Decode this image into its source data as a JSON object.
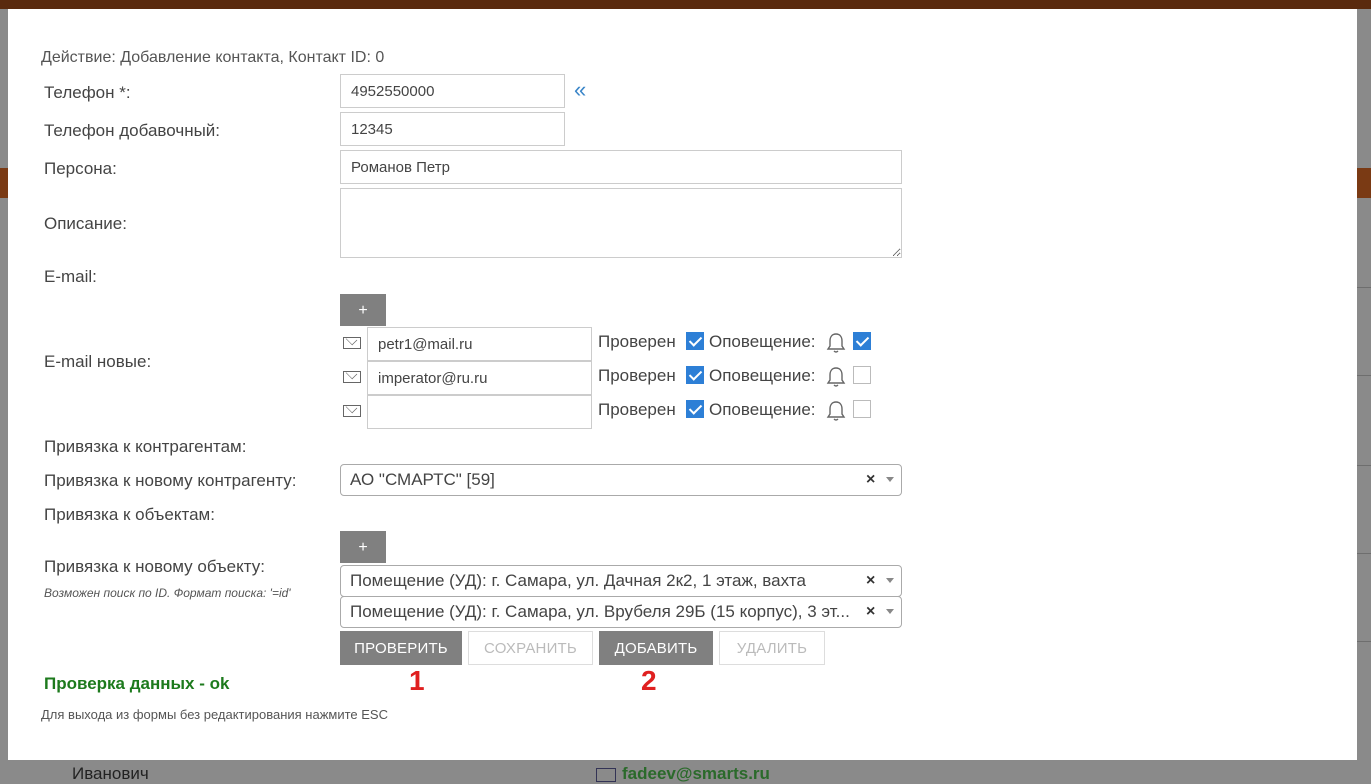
{
  "background": {
    "row_name": "Иванович",
    "row_email": "fadeev@smarts.ru"
  },
  "form": {
    "action_text": "Действие: Добавление контакта, Контакт ID: 0",
    "phone": {
      "label": "Телефон *:",
      "value": "4952550000",
      "expand_glyph": "«"
    },
    "phone_ext": {
      "label": "Телефон добавочный:",
      "value": "12345"
    },
    "person": {
      "label": "Персона:",
      "value": "Романов Петр"
    },
    "description": {
      "label": "Описание:",
      "value": ""
    },
    "email_label": "E-mail:",
    "emails_new": {
      "label": "E-mail новые:",
      "add_label": "+",
      "verified_label": "Проверен",
      "notify_label": "Оповещение:",
      "items": [
        {
          "value": "petr1@mail.ru",
          "verified": true,
          "notify": true
        },
        {
          "value": "imperator@ru.ru",
          "verified": true,
          "notify": false
        },
        {
          "value": "",
          "verified": true,
          "notify": false
        }
      ]
    },
    "counterparties_label": "Привязка к контрагентам:",
    "new_counterparty": {
      "label": "Привязка к новому контрагенту:",
      "value": "АО \"СМАРТС\" [59]"
    },
    "objects_label": "Привязка к объектам:",
    "new_object": {
      "label": "Привязка к новому объекту:",
      "hint": "Возможен поиск по ID. Формат поиска: '=id'",
      "add_label": "+",
      "items": [
        "Помещение (УД): г. Самара, ул. Дачная 2к2, 1 этаж, вахта",
        "Помещение (УД): г. Самара, ул. Врубеля 29Б (15 корпус), 3 эт..."
      ]
    },
    "buttons": {
      "check": "ПРОВЕРИТЬ",
      "save": "СОХРАНИТЬ",
      "add": "ДОБАВИТЬ",
      "delete": "УДАЛИТЬ"
    },
    "markers": {
      "one": "1",
      "two": "2"
    },
    "status_message": "Проверка данных - ok",
    "esc_hint": "Для выхода из формы без редактирования нажмите ESC"
  },
  "colors": {
    "accent": "#2d7fd6",
    "ok": "#1d7a1d",
    "marker": "#e02020",
    "button_dark": "#808080"
  }
}
